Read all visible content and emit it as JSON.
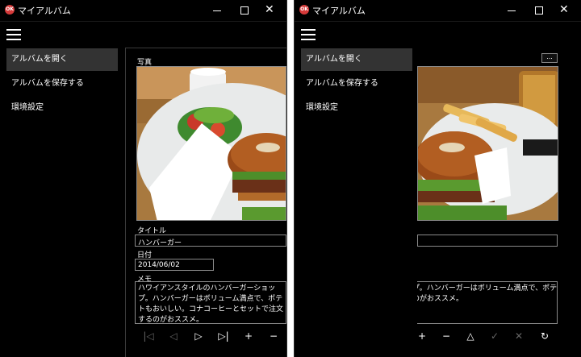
{
  "app": {
    "title": "マイアルバム",
    "icon_text": "OK"
  },
  "nav": [
    {
      "label": "アルバムを開く"
    },
    {
      "label": "アルバムを保存する"
    },
    {
      "label": "環境設定"
    }
  ],
  "form": {
    "photo_label": "写真",
    "title_label": "タイトル",
    "title_value": "ハンバーガー",
    "date_label": "日付",
    "date_value": "2014/06/02",
    "memo_label": "メモ",
    "memo_value": "ハワイアンスタイルのハンバーガーショップ。ハンバーガーはボリューム満点で、ポテトもおいしい。コナコーヒーとセットで注文するのがおススメ。"
  },
  "browse_button": {
    "label": "..."
  },
  "toolbar_left": [
    {
      "name": "first-icon",
      "glyph": "|◁",
      "enabled": false
    },
    {
      "name": "prev-icon",
      "glyph": "◁",
      "enabled": false
    },
    {
      "name": "next-icon",
      "glyph": "▷",
      "enabled": true
    },
    {
      "name": "last-icon",
      "glyph": "▷|",
      "enabled": true
    },
    {
      "name": "add-icon",
      "glyph": "+",
      "enabled": true
    },
    {
      "name": "remove-icon",
      "glyph": "−",
      "enabled": true
    }
  ],
  "toolbar_right": [
    {
      "name": "add-icon",
      "glyph": "+",
      "enabled": true
    },
    {
      "name": "remove-icon",
      "glyph": "−",
      "enabled": true
    },
    {
      "name": "upload-icon",
      "glyph": "△",
      "enabled": true
    },
    {
      "name": "confirm-icon",
      "glyph": "✓",
      "enabled": false
    },
    {
      "name": "cancel-icon",
      "glyph": "✕",
      "enabled": false
    },
    {
      "name": "refresh-icon",
      "glyph": "↻",
      "enabled": true
    }
  ],
  "colors": {
    "background": "#000000",
    "selection": "#333333",
    "border": "#8a8a8a",
    "app_icon": "#d63a3a"
  }
}
